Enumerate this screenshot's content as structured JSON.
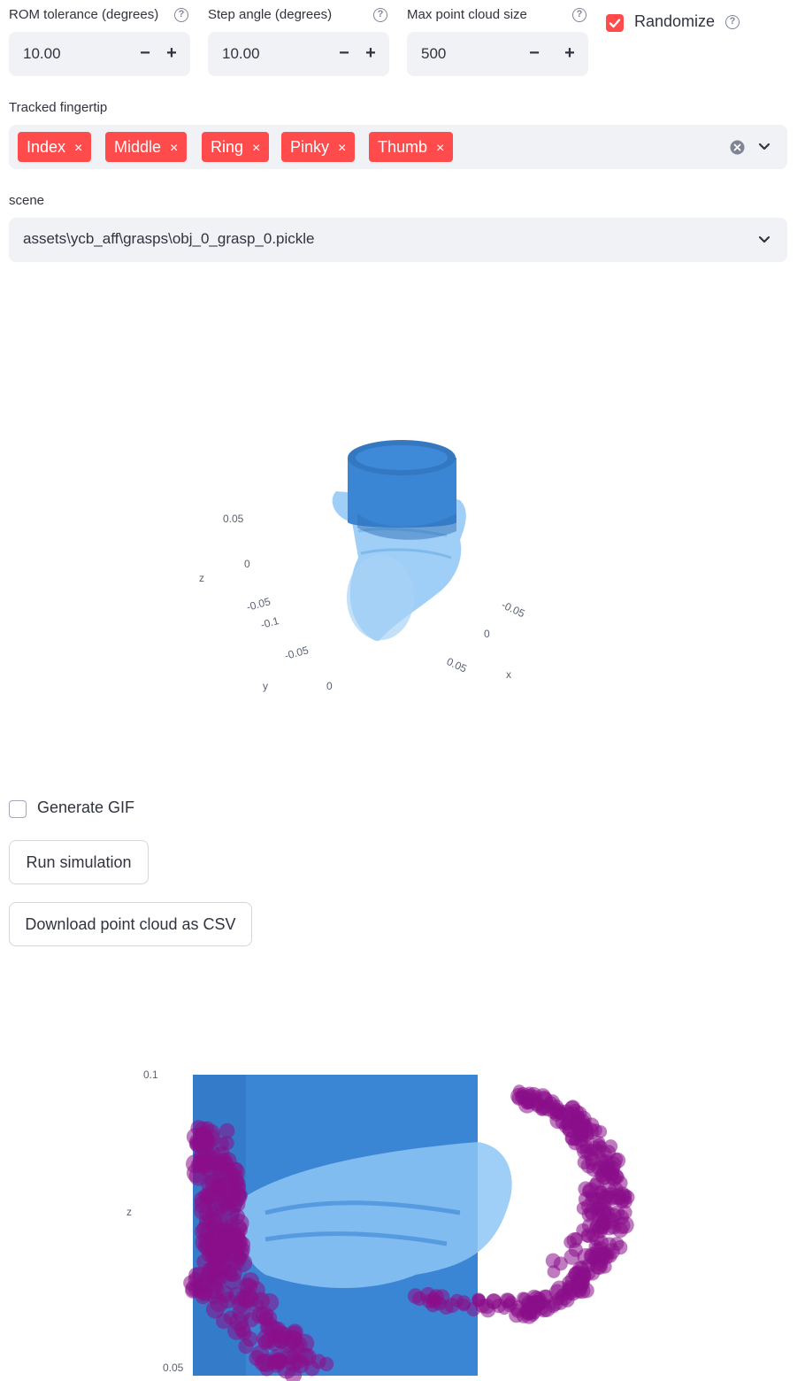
{
  "inputs": {
    "rom": {
      "label": "ROM tolerance (degrees)",
      "value": "10.00"
    },
    "step": {
      "label": "Step angle (degrees)",
      "value": "10.00"
    },
    "max_points": {
      "label": "Max point cloud size",
      "value": "500"
    },
    "stepper": {
      "minus": "−",
      "plus": "+"
    },
    "help_glyph": "?"
  },
  "randomize": {
    "label": "Randomize",
    "checked": true
  },
  "fingertip": {
    "label": "Tracked fingertip",
    "tags": [
      "Index",
      "Middle",
      "Ring",
      "Pinky",
      "Thumb"
    ],
    "remove_glyph": "×"
  },
  "scene": {
    "label": "scene",
    "value": "assets\\ycb_aff\\grasps\\obj_0_grasp_0.pickle"
  },
  "plot1": {
    "axis_titles": {
      "x": "x",
      "y": "y",
      "z": "z"
    },
    "ticks": {
      "z": [
        "0.05",
        "0",
        "-0.05",
        "-0.1"
      ],
      "y": [
        "-0.05",
        "0"
      ],
      "x": [
        "-0.05",
        "0",
        "0.05"
      ]
    }
  },
  "generate_gif": {
    "label": "Generate GIF",
    "checked": false
  },
  "buttons": {
    "run": "Run simulation",
    "download": "Download point cloud as CSV"
  },
  "plot2": {
    "axis_titles": {
      "z": "z"
    },
    "ticks": {
      "z": [
        "0.1",
        "0.05"
      ]
    }
  },
  "colors": {
    "accent": "#ff4b4b",
    "mesh_dark": "#3a86d4",
    "mesh_light": "#7fbcf0",
    "points": "#8b0f8b"
  }
}
